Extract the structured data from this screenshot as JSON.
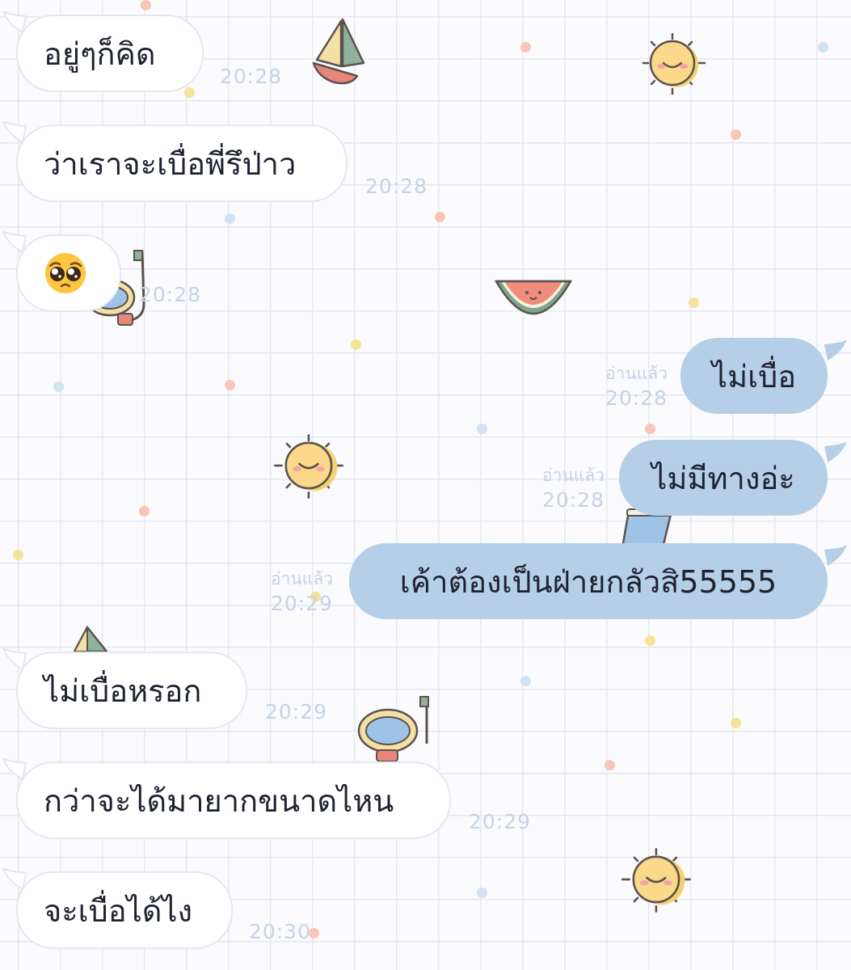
{
  "colors": {
    "incoming_bubble": "#ffffff",
    "outgoing_bubble": "#b5cfe9",
    "timestamp": "#c5d3e5",
    "grid": "#e6e8ee"
  },
  "messages": [
    {
      "direction": "in",
      "text": "อยู่ๆก็คิด",
      "time": "20:28"
    },
    {
      "direction": "in",
      "text": "ว่าเราจะเบื่อพี่รึป่าว",
      "time": "20:28"
    },
    {
      "direction": "in",
      "emoji": "pleading-face-emoji",
      "time": "20:28"
    },
    {
      "direction": "out",
      "text": "ไม่เบื่อ",
      "read": "อ่านแล้ว",
      "time": "20:28"
    },
    {
      "direction": "out",
      "text": "ไม่มีทางอ่ะ",
      "read": "อ่านแล้ว",
      "time": "20:28"
    },
    {
      "direction": "out",
      "text": "เค้าต้องเป็นฝ่ายกลัวสิ55555",
      "read": "อ่านแล้ว",
      "time": "20:29"
    },
    {
      "direction": "in",
      "text": "ไม่เบื่อหรอก",
      "time": "20:29"
    },
    {
      "direction": "in",
      "text": "กว่าจะได้มายากขนาดไหน",
      "time": "20:29"
    },
    {
      "direction": "in",
      "text": "จะเบื่อได้ไง",
      "time": "20:30"
    }
  ],
  "decorations": [
    "sailboat-sticker",
    "sun-sticker",
    "watermelon-sticker",
    "snorkel-mask-sticker",
    "drink-sticker"
  ]
}
